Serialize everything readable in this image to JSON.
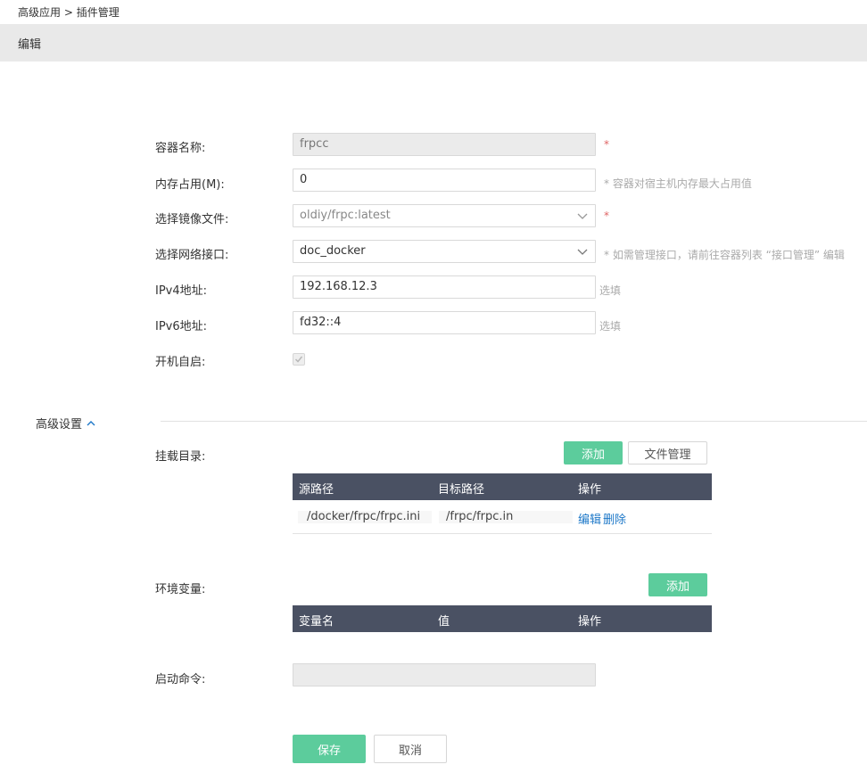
{
  "breadcrumb": {
    "parent": "高级应用",
    "separator": ">",
    "current": "插件管理"
  },
  "header": {
    "title": "编辑"
  },
  "form": {
    "container_name": {
      "label": "容器名称:",
      "value": "frpcc",
      "required": "*"
    },
    "memory": {
      "label": "内存占用(M):",
      "value": "0",
      "hint": "* 容器对宿主机内存最大占用值"
    },
    "image": {
      "label": "选择镜像文件:",
      "value": "oldiy/frpc:latest",
      "required": "*"
    },
    "network": {
      "label": "选择网络接口:",
      "value": "doc_docker",
      "hint": "* 如需管理接口，请前往容器列表 “接口管理” 编辑"
    },
    "ipv4": {
      "label": "IPv4地址:",
      "value": "192.168.12.3",
      "hint": "选填"
    },
    "ipv6": {
      "label": "IPv6地址:",
      "value": "fd32::4",
      "hint": "选填"
    },
    "autostart": {
      "label": "开机自启:",
      "checked": true
    }
  },
  "advanced": {
    "toggle_label": "高级设置"
  },
  "mounts": {
    "label": "挂载目录:",
    "add_label": "添加",
    "file_manage_label": "文件管理",
    "columns": [
      "源路径",
      "目标路径",
      "操作"
    ],
    "rows": [
      {
        "source": "/docker/frpc/frpc.ini",
        "target": "/frpc/frpc.in",
        "edit": "编辑",
        "delete": "删除"
      }
    ]
  },
  "env": {
    "label": "环境变量:",
    "add_label": "添加",
    "columns": [
      "变量名",
      "值",
      "操作"
    ]
  },
  "startup": {
    "label": "启动命令:",
    "value": ""
  },
  "actions": {
    "save": "保存",
    "cancel": "取消"
  },
  "colors": {
    "accent_green": "#5ccc9c",
    "table_header": "#4a5163",
    "link_blue": "#1e78c8",
    "required_red": "#e06666"
  }
}
